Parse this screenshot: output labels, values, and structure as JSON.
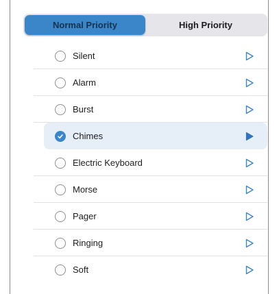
{
  "tabs": [
    {
      "label": "Normal Priority",
      "active": true
    },
    {
      "label": "High Priority",
      "active": false
    }
  ],
  "sounds": [
    {
      "name": "Silent",
      "selected": false
    },
    {
      "name": "Alarm",
      "selected": false
    },
    {
      "name": "Burst",
      "selected": false
    },
    {
      "name": "Chimes",
      "selected": true
    },
    {
      "name": "Electric Keyboard",
      "selected": false
    },
    {
      "name": "Morse",
      "selected": false
    },
    {
      "name": "Pager",
      "selected": false
    },
    {
      "name": "Ringing",
      "selected": false
    },
    {
      "name": "Soft",
      "selected": false
    }
  ],
  "colors": {
    "accent": "#3a86c8",
    "selected_row": "#e6eef8",
    "segment_bg": "#e5e5ea"
  },
  "icons": {
    "play": "play-outline-icon",
    "play_active": "play-filled-icon",
    "check": "checkmark-circle-icon"
  }
}
